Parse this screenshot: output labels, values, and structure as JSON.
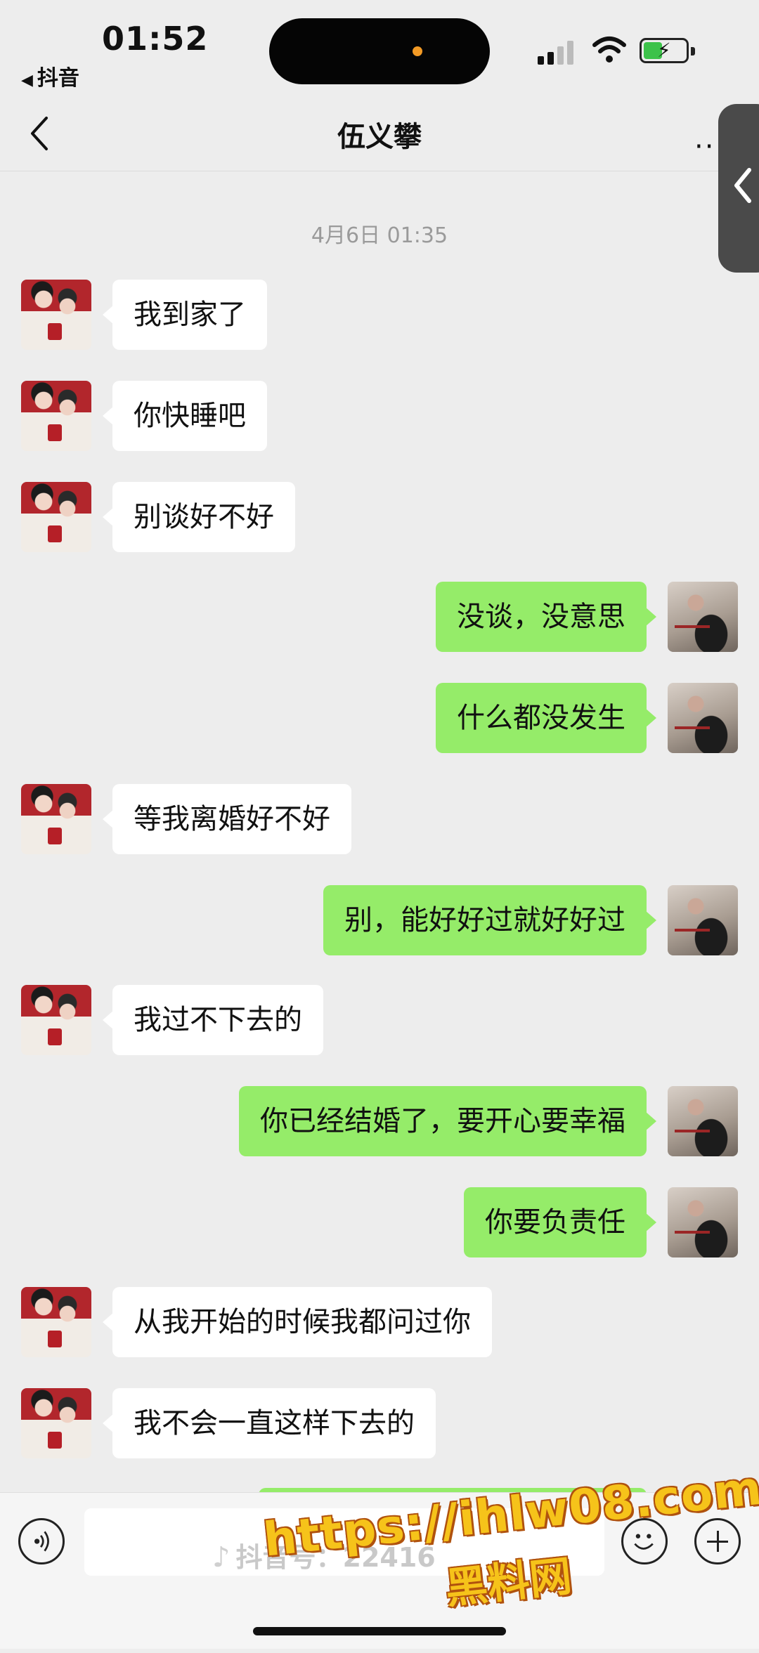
{
  "status_bar": {
    "time": "01:52",
    "back_app": "抖音",
    "island_dot_color": "#f29a25",
    "battery_color": "#3cc24a"
  },
  "nav": {
    "back_icon": "chevron-left-icon",
    "title": "伍义攀",
    "more": "··"
  },
  "chat": {
    "timestamp": "4月6日 01:35",
    "messages": [
      {
        "side": "left",
        "text": "我到家了"
      },
      {
        "side": "left",
        "text": "你快睡吧"
      },
      {
        "side": "left",
        "text": "别谈好不好"
      },
      {
        "side": "right",
        "text": "没谈，没意思"
      },
      {
        "side": "right",
        "text": "什么都没发生"
      },
      {
        "side": "left",
        "text": "等我离婚好不好"
      },
      {
        "side": "right",
        "text": "别，能好好过就好好过"
      },
      {
        "side": "left",
        "text": "我过不下去的"
      },
      {
        "side": "right",
        "text": "你已经结婚了，要开心要幸福"
      },
      {
        "side": "right",
        "text": "你要负责任"
      },
      {
        "side": "left",
        "text": "从我开始的时候我都问过你"
      },
      {
        "side": "left",
        "text": "我不会一直这样下去的"
      }
    ],
    "bubble_colors": {
      "left": "#ffffff",
      "right": "#95ec69"
    }
  },
  "input_bar": {
    "voice_icon": "voice-icon",
    "emoji_icon": "emoji-icon",
    "plus_icon": "plus-icon",
    "input_value": ""
  },
  "overlay": {
    "douyin_id": "抖音号：22416",
    "watermark_url": "https://ihlw08.com",
    "watermark_name": "黑料网"
  }
}
